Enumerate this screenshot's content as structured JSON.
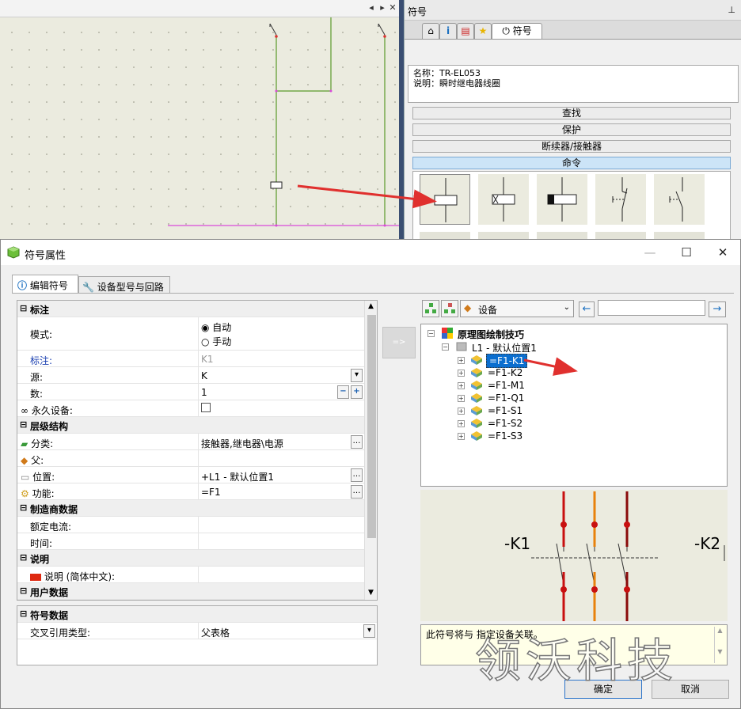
{
  "symbol_panel": {
    "title": "符号",
    "tab_label": "符号",
    "name_line": "名称：TR-EL053",
    "desc_line": "说明：瞬时继电器线圈",
    "categories": [
      "查找",
      "保护",
      "断续器/接触器",
      "命令"
    ]
  },
  "dialog": {
    "title": "符号属性",
    "tabs": [
      "编辑符号",
      "设备型号与回路"
    ],
    "properties": {
      "cat_annotation": "标注",
      "mode_label": "模式:",
      "mode_auto": "自动",
      "mode_manual": "手动",
      "mark_label": "标注:",
      "mark_value": "K1",
      "source_label": "源:",
      "source_value": "K",
      "count_label": "数:",
      "count_value": "1",
      "permanent_label": "永久设备:",
      "cat_hierarchy": "层级结构",
      "class_label": "分类:",
      "class_value": "接触器,继电器\\电源",
      "parent_label": "父:",
      "location_label": "位置:",
      "location_value": "+L1 - 默认位置1",
      "function_label": "功能:",
      "function_value": "=F1",
      "cat_manufacturer": "制造商数据",
      "rated_current_label": "额定电流:",
      "time_label": "时间:",
      "cat_description": "说明",
      "desc_cn_label": "说明 (简体中文):",
      "cat_user": "用户数据"
    },
    "symbol_data": {
      "header": "符号数据",
      "xref_label": "交叉引用类型:",
      "xref_value": "父表格"
    },
    "transfer_label": "=>",
    "device_combo": "设备",
    "search_value": "",
    "tree": {
      "root": "原理图绘制技巧",
      "location": "L1 - 默认位置1",
      "devices": [
        "=F1-K1",
        "=F1-K2",
        "=F1-M1",
        "=F1-Q1",
        "=F1-S1",
        "=F1-S2",
        "=F1-S3"
      ]
    },
    "preview": {
      "left_label": "-K1",
      "right_label": "-K2"
    },
    "description": "此符号将与 指定设备关联。",
    "ok": "确定",
    "cancel": "取消"
  },
  "watermark": "领沃科技",
  "colors": {
    "accent": "#2d74c9",
    "highlight": "#0a6ecf",
    "arrow": "#e0302e",
    "wire_green": "#4e9a28",
    "wire_magenta": "#d94ad9"
  }
}
